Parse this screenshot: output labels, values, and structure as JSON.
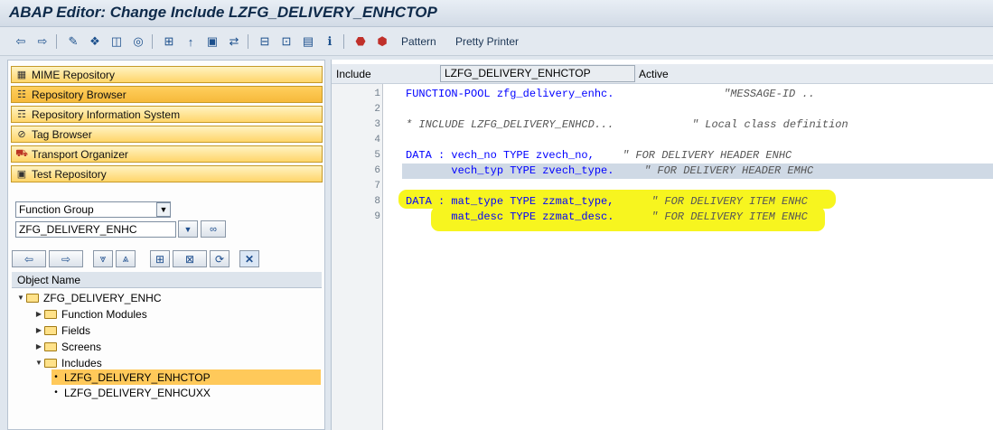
{
  "window": {
    "title": "ABAP Editor: Change Include LZFG_DELIVERY_ENHCTOP"
  },
  "toolbar": {
    "icons": [
      "back-arrow-icon",
      "forward-arrow-icon",
      "pencil-check-icon",
      "activate-icon",
      "where-used-icon",
      "object-list-icon",
      "hierarchy-icon",
      "breakpoint-icon",
      "display-object-icon",
      "navigate-icon",
      "structure-icon",
      "find-icon",
      "info-icon",
      "help-icon",
      "delete-icon",
      "rename-icon"
    ],
    "pattern_label": "Pattern",
    "pretty_printer_label": "Pretty Printer"
  },
  "nav": {
    "items": [
      {
        "label": "MIME Repository",
        "icon": "mime-icon"
      },
      {
        "label": "Repository Browser",
        "icon": "browser-icon"
      },
      {
        "label": "Repository Information System",
        "icon": "info-system-icon"
      },
      {
        "label": "Tag Browser",
        "icon": "tag-icon"
      },
      {
        "label": "Transport Organizer",
        "icon": "truck-icon"
      },
      {
        "label": "Test Repository",
        "icon": "test-icon"
      }
    ],
    "object_type": "Function Group",
    "object_name": "ZFG_DELIVERY_ENHC"
  },
  "tree": {
    "header": "Object Name",
    "root": "ZFG_DELIVERY_ENHC",
    "children": [
      "Function Modules",
      "Fields",
      "Screens",
      "Includes"
    ],
    "includes": [
      "LZFG_DELIVERY_ENHCTOP",
      "LZFG_DELIVERY_ENHCUXX"
    ]
  },
  "editor": {
    "include_label": "Include",
    "include_name": "LZFG_DELIVERY_ENHCTOP",
    "status": "Active",
    "lines": [
      {
        "num": "1",
        "code": "FUNCTION-POOL zfg_delivery_enhc.",
        "comment": "\"MESSAGE-ID .."
      },
      {
        "num": "2",
        "code": "",
        "comment": ""
      },
      {
        "num": "3",
        "code": "",
        "comment": "* INCLUDE LZFG_DELIVERY_ENHCD...            \" Local class definition"
      },
      {
        "num": "4",
        "code": "",
        "comment": ""
      },
      {
        "num": "5",
        "code": "DATA : vech_no TYPE zvech_no,",
        "comment": "\" FOR DELIVERY HEADER ENHC"
      },
      {
        "num": "6",
        "code": "       vech_typ TYPE zvech_type.",
        "comment": "\" FOR DELIVERY HEADER EMHC"
      },
      {
        "num": "7",
        "code": "",
        "comment": ""
      },
      {
        "num": "8",
        "code": "DATA : mat_type TYPE zzmat_type,",
        "comment": "\" FOR DELIVERY ITEM ENHC"
      },
      {
        "num": "9",
        "code": "       mat_desc TYPE zzmat_desc.",
        "comment": "\" FOR DELIVERY ITEM ENHC"
      }
    ]
  },
  "colors": {
    "highlight": "#f7f51f",
    "nav_active": "#ffcf5e",
    "keyword": "#0000ff"
  }
}
